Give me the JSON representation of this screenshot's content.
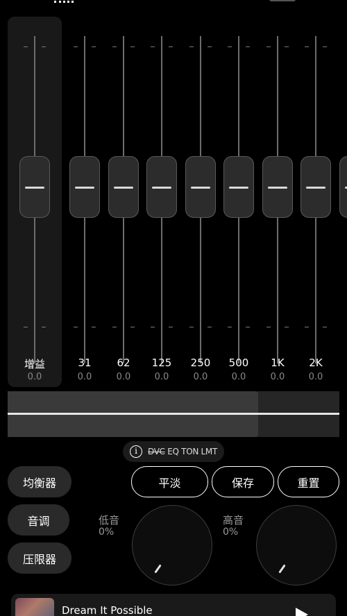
{
  "eq": {
    "gain": {
      "label": "增益",
      "value": "0.0"
    },
    "bands": [
      {
        "label": "31",
        "value": "0.0"
      },
      {
        "label": "62",
        "value": "0.0"
      },
      {
        "label": "125",
        "value": "0.0"
      },
      {
        "label": "250",
        "value": "0.0"
      },
      {
        "label": "500",
        "value": "0.0"
      },
      {
        "label": "1K",
        "value": "0.0"
      },
      {
        "label": "2K",
        "value": "0.0"
      }
    ]
  },
  "chip": {
    "strike_text": "DVC",
    "text": "EQ TON LMT"
  },
  "side": {
    "equalizer": "均衡器",
    "tone": "音调",
    "limiter": "压限器"
  },
  "presets": {
    "flat": "平淡",
    "save": "保存",
    "reset": "重置"
  },
  "knobs": {
    "bass": {
      "label": "低音",
      "value": "0%"
    },
    "treble": {
      "label": "高音",
      "value": "0%"
    }
  },
  "player": {
    "title": "Dream It Possible"
  },
  "colors": {
    "background": "#000000",
    "panel": "#191919",
    "accent": "#ffffff"
  }
}
